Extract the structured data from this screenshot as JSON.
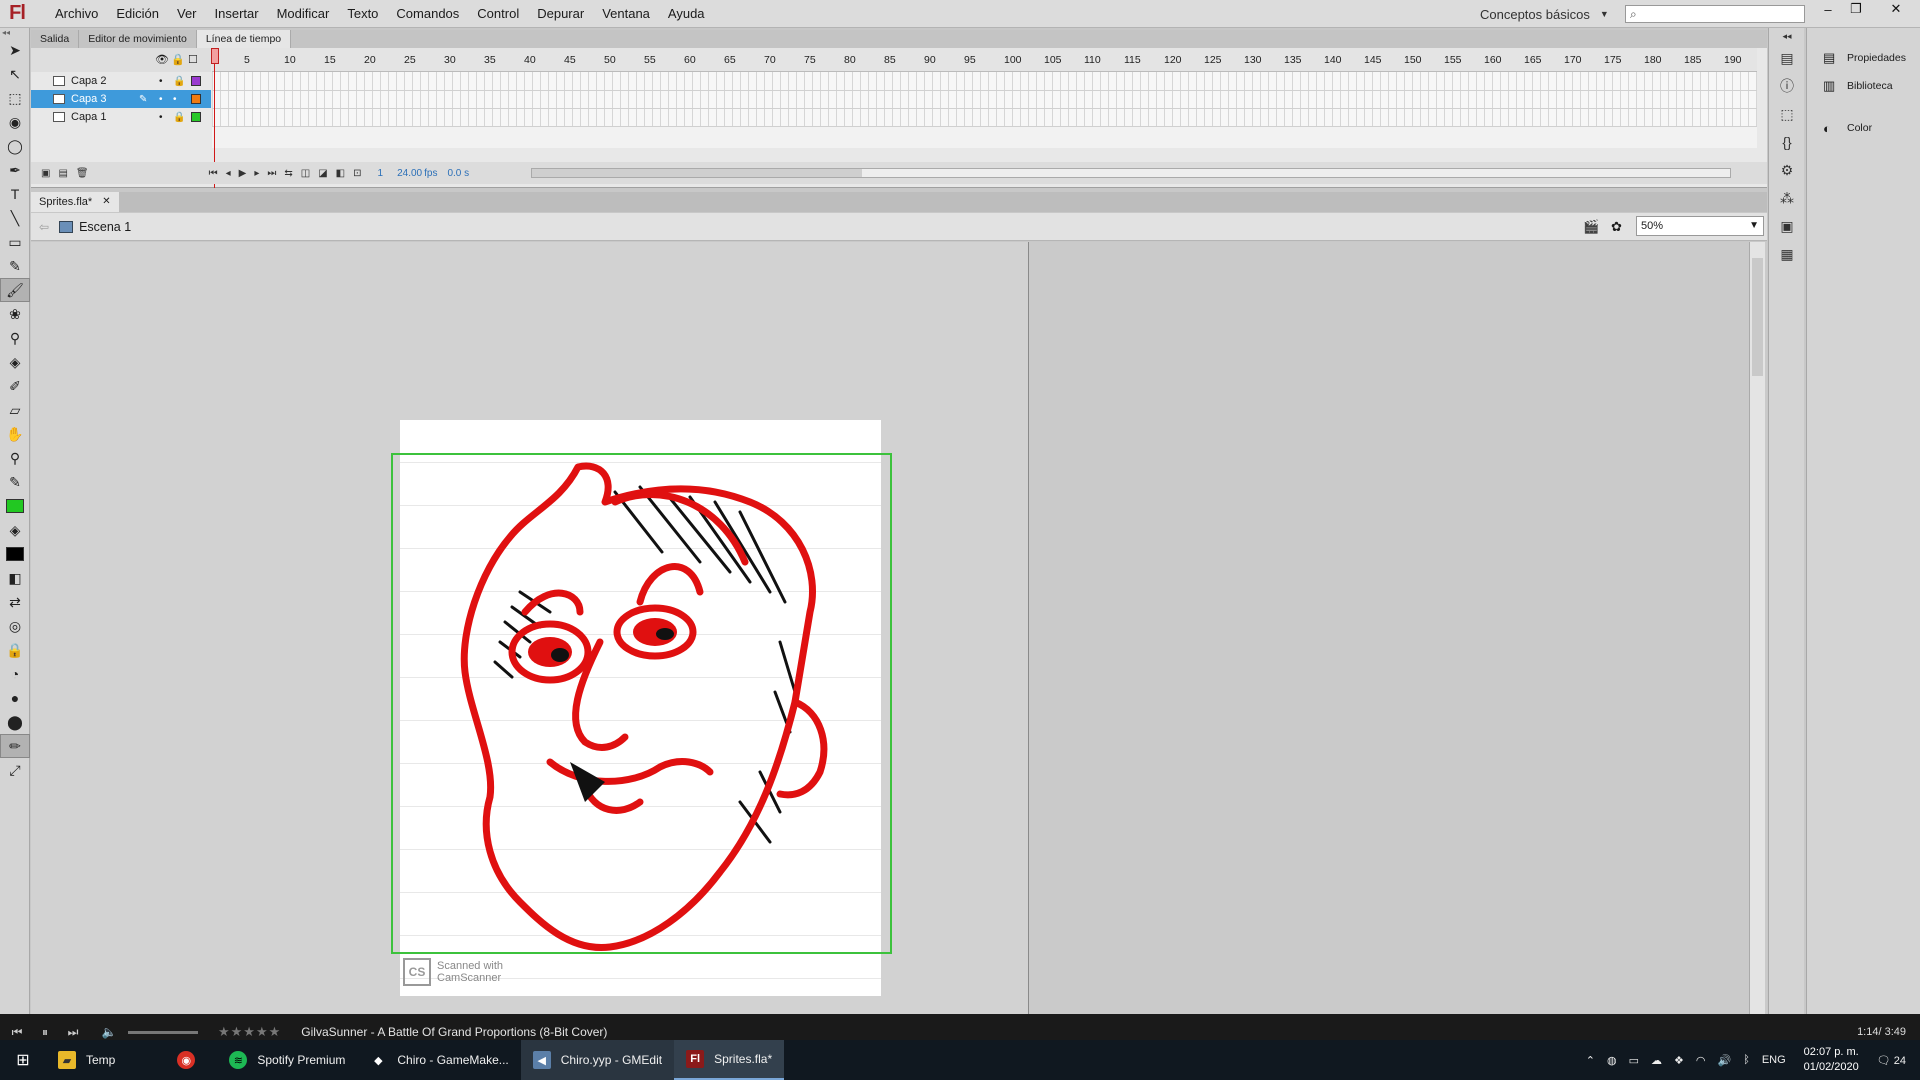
{
  "app": {
    "logo": "Fl"
  },
  "menu": [
    "Archivo",
    "Edición",
    "Ver",
    "Insertar",
    "Modificar",
    "Texto",
    "Comandos",
    "Control",
    "Depurar",
    "Ventana",
    "Ayuda"
  ],
  "workspace": {
    "label": "Conceptos básicos"
  },
  "search": {
    "placeholder": ""
  },
  "window_controls": {
    "minimize": "–",
    "restore": "❐",
    "close": "✕"
  },
  "panel_tabs": [
    "Salida",
    "Editor de movimiento",
    "Línea de tiempo"
  ],
  "timeline": {
    "layers": [
      {
        "name": "Capa 2",
        "color": "#9a3ad0",
        "selected": false
      },
      {
        "name": "Capa 3",
        "color": "#f07a10",
        "selected": true
      },
      {
        "name": "Capa 1",
        "color": "#28c828",
        "selected": false
      }
    ],
    "ruler": [
      "1",
      "5",
      "10",
      "15",
      "20",
      "25",
      "30",
      "35",
      "40",
      "45",
      "50",
      "55",
      "60",
      "65",
      "70",
      "75",
      "80",
      "85",
      "90",
      "95",
      "100",
      "105",
      "110",
      "115",
      "120",
      "125",
      "130",
      "135",
      "140",
      "145",
      "150",
      "155",
      "160",
      "165",
      "170",
      "175",
      "180",
      "185",
      "190"
    ],
    "current_frame": "1",
    "fps": "24.00",
    "fps_unit": "fps",
    "seconds": "0.0 s"
  },
  "document": {
    "tab": "Sprites.fla*",
    "scene": "Escena 1",
    "zoom": "50%"
  },
  "stage": {
    "watermark_line1": "Scanned with",
    "watermark_line2": "CamScanner",
    "watermark_logo": "CS"
  },
  "colors": {
    "stroke": "#22c822",
    "fill": "#000000",
    "accent": "#3e9adb",
    "drawing": "#e01010"
  },
  "right_panels": [
    "Propiedades",
    "Biblioteca",
    "Color"
  ],
  "media": {
    "title": "GilvaSunner - A Battle Of Grand Proportions (8-Bit Cover)",
    "time": "1:14/ 3:49",
    "rating": "★★★★★",
    "progress": 0.32
  },
  "taskbar": {
    "apps": [
      {
        "label": "Temp",
        "icon": "folder-icon"
      },
      {
        "label": "",
        "icon": "chrome-icon"
      },
      {
        "label": "Spotify Premium",
        "icon": "spotify-icon"
      },
      {
        "label": "Chiro - GameMake...",
        "icon": "gamemaker-icon"
      },
      {
        "label": "Chiro.yyp - GMEdit",
        "icon": "gmedit-icon"
      },
      {
        "label": "Sprites.fla*",
        "icon": "flash-icon"
      }
    ],
    "lang": "ENG",
    "time": "02:07 p. m.",
    "date": "01/02/2020",
    "notifications": "24"
  }
}
